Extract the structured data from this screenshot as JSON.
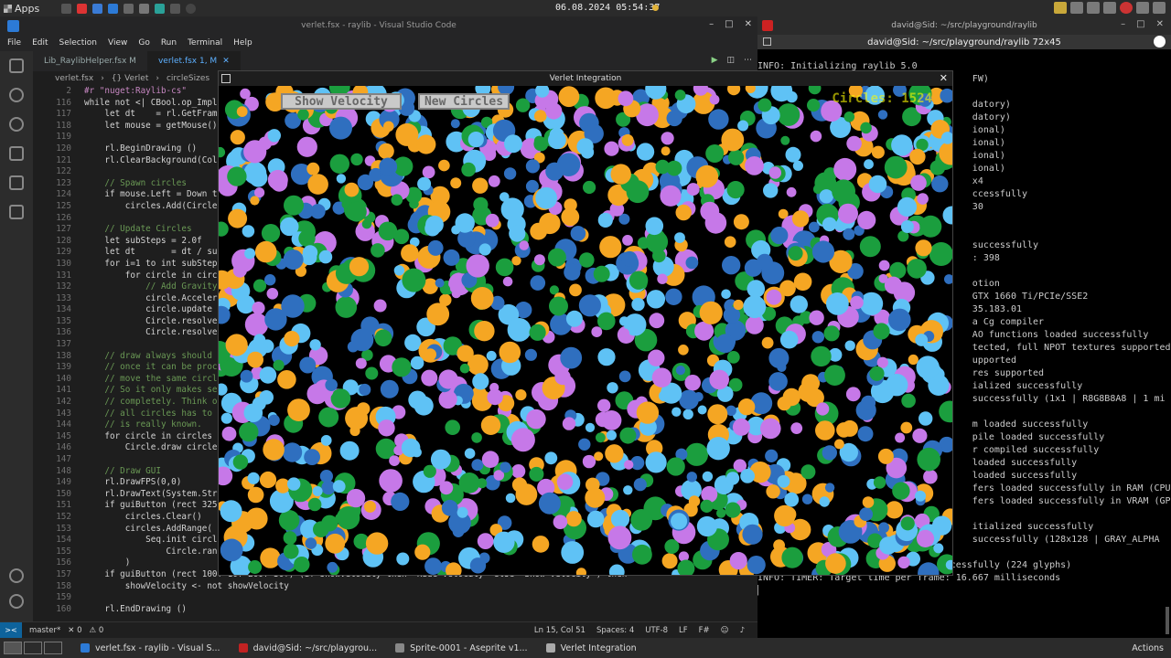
{
  "top_panel": {
    "apps_label": "Apps",
    "clock": "06.08.2024 05:54:37"
  },
  "vscode": {
    "title": "verlet.fsx - raylib - Visual Studio Code",
    "menu": [
      "File",
      "Edit",
      "Selection",
      "View",
      "Go",
      "Run",
      "Terminal",
      "Help"
    ],
    "tabs": [
      {
        "label": "Lib_RaylibHelper.fsx  M",
        "active": false
      },
      {
        "label": "verlet.fsx 1, M",
        "active": true
      }
    ],
    "breadcrumb": [
      "verlet.fsx",
      "{} Verlet",
      "circleSizes"
    ],
    "status": {
      "branch": "master*",
      "errors": "0",
      "warnings": "0",
      "position": "Ln 15, Col 51",
      "spaces": "Spaces: 4",
      "encoding": "UTF-8",
      "eol": "LF",
      "language": "F#"
    },
    "lines": [
      {
        "n": "2",
        "t": "#r \"nuget:Raylib-cs\"",
        "c": "kw"
      },
      {
        "n": "116",
        "t": "while not <| CBool.op_Implic",
        "c": ""
      },
      {
        "n": "117",
        "t": "    let dt    = rl.GetFrameT",
        "c": ""
      },
      {
        "n": "118",
        "t": "    let mouse = getMouse()",
        "c": ""
      },
      {
        "n": "119",
        "t": "",
        "c": ""
      },
      {
        "n": "120",
        "t": "    rl.BeginDrawing ()",
        "c": ""
      },
      {
        "n": "121",
        "t": "    rl.ClearBackground(Color",
        "c": ""
      },
      {
        "n": "122",
        "t": "",
        "c": ""
      },
      {
        "n": "123",
        "t": "    // Spawn circles",
        "c": "comment"
      },
      {
        "n": "124",
        "t": "    if mouse.Left = Down the",
        "c": ""
      },
      {
        "n": "125",
        "t": "        circles.Add(Circle.i",
        "c": ""
      },
      {
        "n": "126",
        "t": "",
        "c": ""
      },
      {
        "n": "127",
        "t": "    // Update Circles",
        "c": "comment"
      },
      {
        "n": "128",
        "t": "    let subSteps = 2.0f",
        "c": ""
      },
      {
        "n": "129",
        "t": "    let dt       = dt / subS",
        "c": ""
      },
      {
        "n": "130",
        "t": "    for i=1 to int subSteps",
        "c": ""
      },
      {
        "n": "131",
        "t": "        for circle in circle",
        "c": ""
      },
      {
        "n": "132",
        "t": "            // Add Gravity",
        "c": "comment"
      },
      {
        "n": "133",
        "t": "            circle.Accelerat",
        "c": ""
      },
      {
        "n": "134",
        "t": "            circle.update ci",
        "c": ""
      },
      {
        "n": "135",
        "t": "            Circle.resolveSc",
        "c": ""
      },
      {
        "n": "136",
        "t": "            Circle.resolveCo",
        "c": ""
      },
      {
        "n": "137",
        "t": "",
        "c": ""
      },
      {
        "n": "138",
        "t": "    // draw always should be",
        "c": "comment"
      },
      {
        "n": "139",
        "t": "    // once it can be proces",
        "c": "comment"
      },
      {
        "n": "140",
        "t": "    // move the same circle",
        "c": "comment"
      },
      {
        "n": "141",
        "t": "    // So it only makes sens",
        "c": "comment"
      },
      {
        "n": "142",
        "t": "    // completely. Think of",
        "c": "comment"
      },
      {
        "n": "143",
        "t": "    // all circles has to be",
        "c": "comment"
      },
      {
        "n": "144",
        "t": "    // is really known.",
        "c": "comment"
      },
      {
        "n": "145",
        "t": "    for circle in circles do",
        "c": ""
      },
      {
        "n": "146",
        "t": "        Circle.draw circle",
        "c": ""
      },
      {
        "n": "147",
        "t": "",
        "c": ""
      },
      {
        "n": "148",
        "t": "    // Draw GUI",
        "c": "comment"
      },
      {
        "n": "149",
        "t": "    rl.DrawFPS(0,0)",
        "c": ""
      },
      {
        "n": "150",
        "t": "    rl.DrawText(System.Strin",
        "c": ""
      },
      {
        "n": "151",
        "t": "    if guiButton (rect 325f",
        "c": ""
      },
      {
        "n": "152",
        "t": "        circles.Clear()",
        "c": ""
      },
      {
        "n": "153",
        "t": "        circles.AddRange(",
        "c": ""
      },
      {
        "n": "154",
        "t": "            Seq.init circleA",
        "c": ""
      },
      {
        "n": "155",
        "t": "                Circle.rando",
        "c": ""
      },
      {
        "n": "156",
        "t": "        )",
        "c": ""
      },
      {
        "n": "157",
        "t": "    if guiButton (rect 100f 10f 200f 30f) (if showVelocity then \"Hide Velocity\" else \"Show Velocity\") then",
        "c": ""
      },
      {
        "n": "158",
        "t": "        showVelocity <- not showVelocity",
        "c": ""
      },
      {
        "n": "159",
        "t": "",
        "c": ""
      },
      {
        "n": "160",
        "t": "    rl.EndDrawing ()",
        "c": ""
      }
    ]
  },
  "terminal": {
    "title": "david@Sid: ~/src/playground/raylib",
    "subtitle": "david@Sid: ~/src/playground/raylib 72x45",
    "lines": [
      "INFO: Initializing raylib 5.0",
      "                                       FW)",
      "",
      "                                       datory)",
      "                                       datory)",
      "                                       ional)",
      "                                       ional)",
      "                                       ional)",
      "                                       ional)",
      "                                       x4",
      "                                       ccessfully",
      "                                       30",
      "",
      "",
      "                                       successfully",
      "                                       : 398",
      "",
      "                                       otion",
      "                                       GTX 1660 Ti/PCIe/SSE2",
      "                                       35.183.01",
      "                                       a Cg compiler",
      "                                       AO functions loaded successfully",
      "                                       tected, full NPOT textures supported",
      "                                       upported",
      "                                       res supported",
      "                                       ialized successfully",
      "                                       successfully (1x1 | R8G8B8A8 | 1 mi",
      "",
      "                                       m loaded successfully",
      "                                       pile loaded successfully",
      "                                       r compiled successfully",
      "                                       loaded successfully",
      "                                       loaded successfully",
      "                                       fers loaded successfully in RAM (CPU)",
      "                                       fers loaded successfully in VRAM (GPU",
      "",
      "                                       itialized successfully",
      "                                       successfully (128x128 | GRAY_ALPHA",
      "",
      "INFO: FONT: Default font loaded successfully (224 glyphs)",
      "INFO: TIMER: Target time per frame: 16.667 milliseconds",
      "▏"
    ]
  },
  "raylib": {
    "title": "Verlet Integration",
    "show_velocity_label": "Show Velocity",
    "new_circles_label": "New Circles",
    "circles_text": "Circles: 1524",
    "colors": [
      "#f5a623",
      "#5fc2f5",
      "#c678e8",
      "#1b9e3e",
      "#2f6fbf"
    ]
  },
  "taskbar": {
    "tasks": [
      {
        "label": "verlet.fsx - raylib - Visual S...",
        "color": "#2c7ad6"
      },
      {
        "label": "david@Sid: ~/src/playgrou...",
        "color": "#c22222"
      },
      {
        "label": "Sprite-0001 - Aseprite v1...",
        "color": "#888888"
      },
      {
        "label": "Verlet Integration",
        "color": "#aaaaaa"
      }
    ],
    "actions_label": "Actions"
  }
}
